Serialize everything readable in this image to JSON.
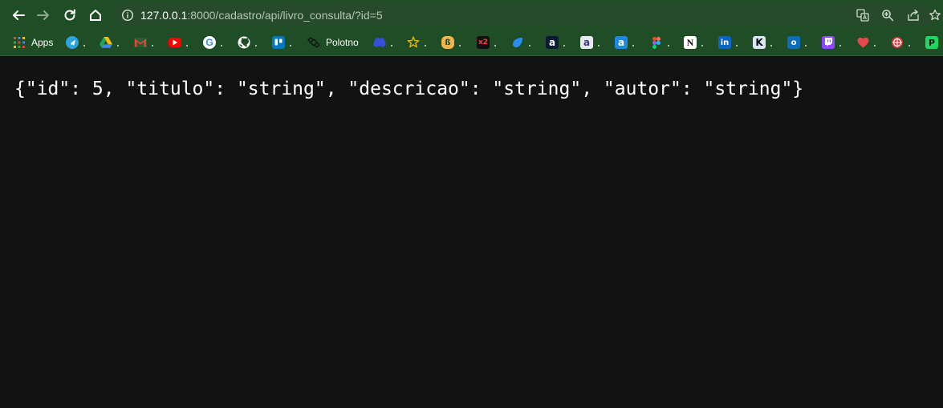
{
  "browser": {
    "url_host": "127.0.0.1",
    "url_path": ":8000/cadastro/api/livro_consulta/?id=5",
    "nav_icons": [
      "back-icon",
      "forward-icon",
      "reload-icon",
      "home-icon"
    ],
    "omnibox_icons": [
      "info-icon",
      "translate-icon",
      "zoom-icon",
      "share-icon",
      "bookmark-star-icon"
    ]
  },
  "bookmarks": [
    {
      "label": "Apps",
      "icon": "apps-grid-icon"
    },
    {
      "label": "",
      "icon": "telegram-icon"
    },
    {
      "label": "",
      "icon": "google-drive-icon"
    },
    {
      "label": "",
      "icon": "gmail-icon"
    },
    {
      "label": "",
      "icon": "youtube-icon"
    },
    {
      "label": "",
      "icon": "google-icon"
    },
    {
      "label": "",
      "icon": "github-icon"
    },
    {
      "label": "",
      "icon": "trello-icon"
    },
    {
      "label": "Polotno",
      "icon": "polotno-icon"
    },
    {
      "label": "",
      "icon": "discord-icon"
    },
    {
      "label": "",
      "icon": "star-icon"
    },
    {
      "label": "",
      "icon": "bookmark-b-icon"
    },
    {
      "label": "",
      "icon": "x2-icon"
    },
    {
      "label": "",
      "icon": "drop-icon"
    },
    {
      "label": "",
      "icon": "letter-a-icon"
    },
    {
      "label": "",
      "icon": "letter-a-light-icon"
    },
    {
      "label": "",
      "icon": "letter-a-blue-icon"
    },
    {
      "label": "",
      "icon": "figma-icon"
    },
    {
      "label": "",
      "icon": "notion-icon"
    },
    {
      "label": "",
      "icon": "linkedin-icon"
    },
    {
      "label": "",
      "icon": "k-icon"
    },
    {
      "label": "",
      "icon": "outlook-icon"
    },
    {
      "label": "",
      "icon": "twitch-icon"
    },
    {
      "label": "",
      "icon": "heart-icon"
    },
    {
      "label": "",
      "icon": "target-icon"
    },
    {
      "label": "",
      "icon": "p-icon"
    }
  ],
  "content": {
    "json_text": "{\"id\": 5, \"titulo\": \"string\", \"descricao\": \"string\", \"autor\": \"string\"}"
  },
  "colors": {
    "toolbar_bg": "#1f4d25",
    "omnibox_bg": "#264a2b",
    "page_bg": "#121212",
    "text": "#ffffff"
  }
}
